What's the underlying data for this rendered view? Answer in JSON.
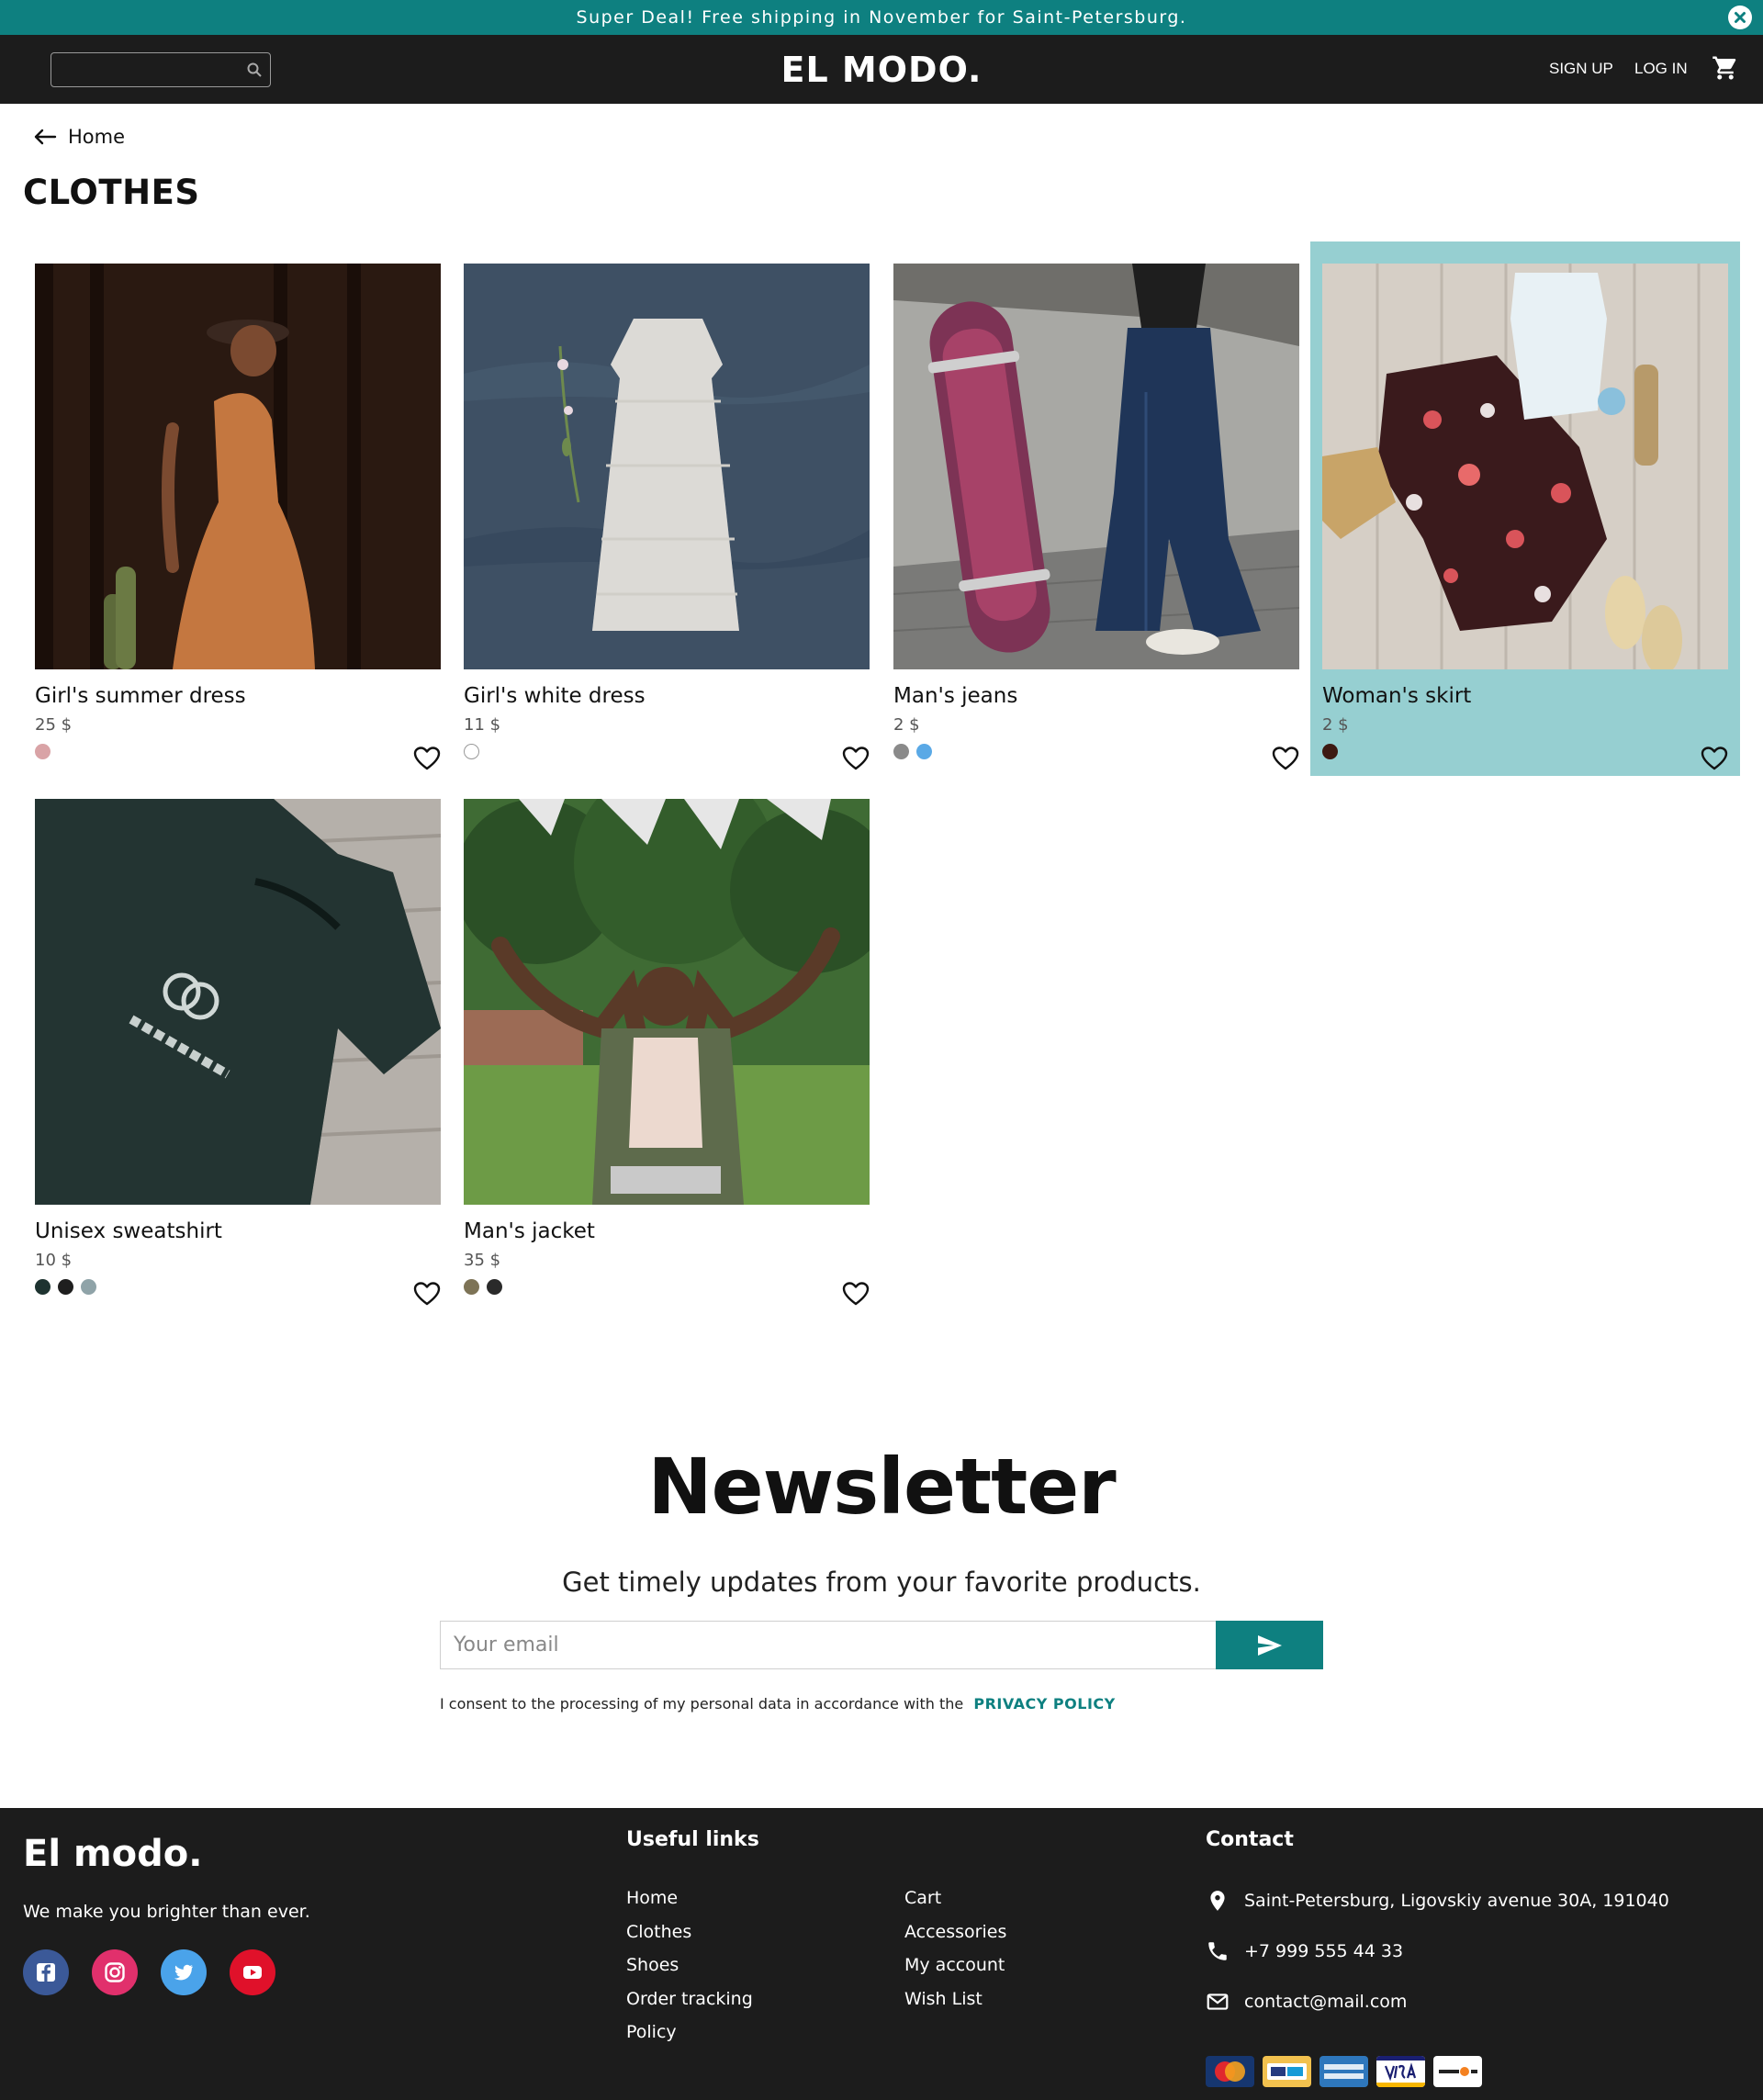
{
  "promo": {
    "text": "Super Deal! Free shipping in November for Saint-Petersburg.",
    "close_icon": "close-circle-icon"
  },
  "header": {
    "search": {
      "placeholder": "",
      "icon": "search-icon"
    },
    "logo": "EL MODO.",
    "sign_up": "SIGN UP",
    "log_in": "LOG IN",
    "cart_icon": "cart-icon"
  },
  "breadcrumb": {
    "back_icon": "arrow-left-icon",
    "label": "Home"
  },
  "page": {
    "title": "CLOTHES"
  },
  "products": [
    {
      "name": "Girl's summer dress",
      "price": "25 $",
      "colors": [
        "#d9a3a6"
      ],
      "highlighted": false
    },
    {
      "name": "Girl's white dress",
      "price": "11 $",
      "colors": [
        "#ffffff"
      ],
      "highlighted": false
    },
    {
      "name": "Man's jeans",
      "price": "2 $",
      "colors": [
        "#8a8a8a",
        "#5aa9e6"
      ],
      "highlighted": false
    },
    {
      "name": "Woman's skirt",
      "price": "2 $",
      "colors": [
        "#3d1a12"
      ],
      "highlighted": true
    },
    {
      "name": "Unisex sweatshirt",
      "price": "10 $",
      "colors": [
        "#1e3330",
        "#1f1f1f",
        "#8fa3a8"
      ],
      "highlighted": false
    },
    {
      "name": "Man's jacket",
      "price": "35 $",
      "colors": [
        "#7d7356",
        "#2a2a2a"
      ],
      "highlighted": false
    }
  ],
  "newsletter": {
    "title": "Newsletter",
    "subtitle": "Get timely updates from your favorite products.",
    "email_placeholder": "Your email",
    "send_icon": "send-icon",
    "consent": "I consent to the processing of my personal data in accordance with the",
    "policy": "PRIVACY POLICY"
  },
  "footer": {
    "brand": "El modo.",
    "tagline": "We make you brighter than ever.",
    "socials": [
      "facebook-icon",
      "instagram-icon",
      "twitter-icon",
      "youtube-icon"
    ],
    "useful_links_title": "Useful links",
    "links_col1": [
      "Home",
      "Clothes",
      "Shoes",
      "Order tracking",
      "Policy"
    ],
    "links_col2": [
      "Cart",
      "Accessories",
      "My account",
      "Wish List"
    ],
    "contact_title": "Contact",
    "address": "Saint-Petersburg, Ligovskiy avenue 30A, 191040",
    "phone": "+7 999 555 44 33",
    "email": "contact@mail.com",
    "payments": [
      "mastercard-icon",
      "paypal-icon",
      "american-express-icon",
      "visa-icon",
      "discover-icon"
    ]
  },
  "colors": {
    "accent": "#0e8080",
    "dark": "#1c1c1c",
    "highlight": "#96cfd1"
  }
}
